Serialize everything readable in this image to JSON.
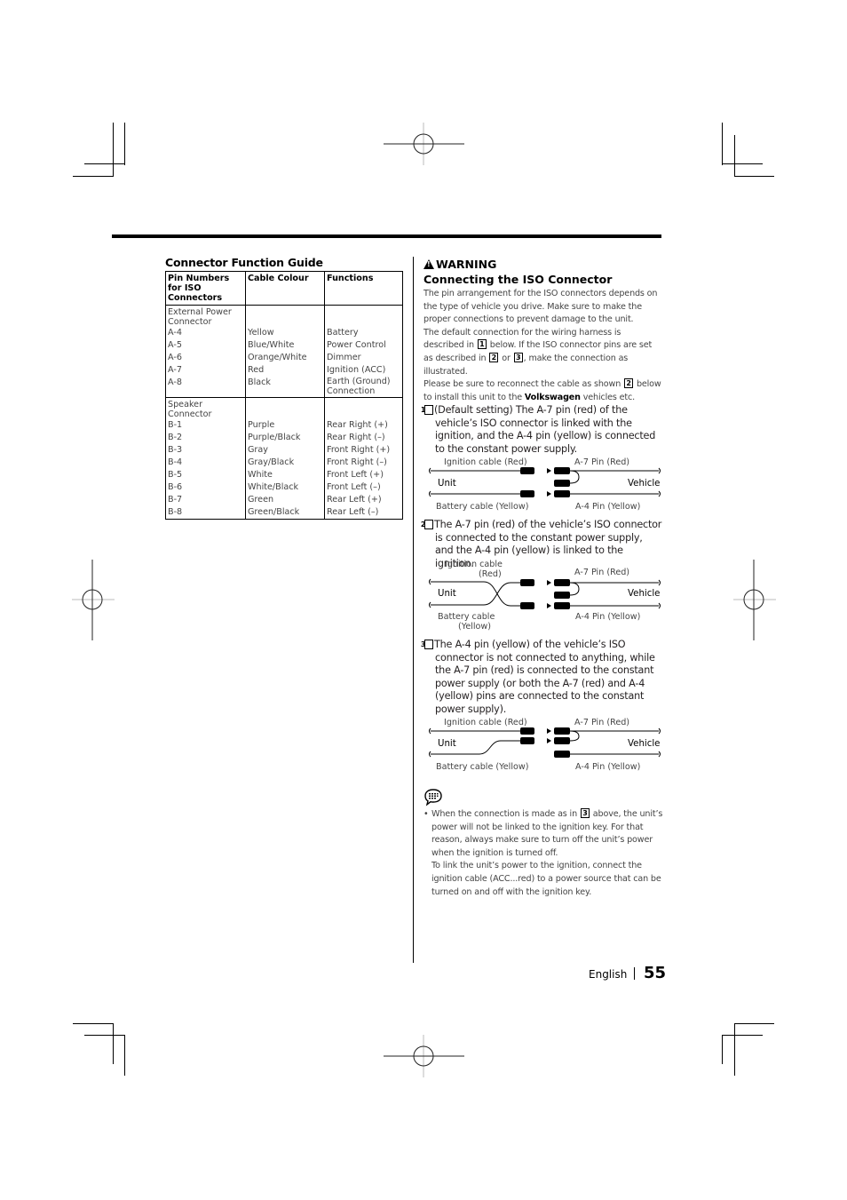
{
  "connector_guide": {
    "title": "Connector Function Guide",
    "headers": [
      "Pin Numbers for ISO Connectors",
      "Cable Colour",
      "Functions"
    ],
    "groups": [
      {
        "name": "External Power Connector",
        "rows": [
          {
            "pin": "A-4",
            "colour": "Yellow",
            "function": "Battery"
          },
          {
            "pin": "A-5",
            "colour": "Blue/White",
            "function": "Power Control"
          },
          {
            "pin": "A-6",
            "colour": "Orange/White",
            "function": "Dimmer"
          },
          {
            "pin": "A-7",
            "colour": "Red",
            "function": "Ignition (ACC)"
          },
          {
            "pin": "A-8",
            "colour": "Black",
            "function": "Earth (Ground) Connection"
          }
        ]
      },
      {
        "name": "Speaker Connector",
        "rows": [
          {
            "pin": "B-1",
            "colour": "Purple",
            "function": "Rear Right (+)"
          },
          {
            "pin": "B-2",
            "colour": "Purple/Black",
            "function": "Rear Right (–)"
          },
          {
            "pin": "B-3",
            "colour": "Gray",
            "function": "Front Right (+)"
          },
          {
            "pin": "B-4",
            "colour": "Gray/Black",
            "function": "Front Right (–)"
          },
          {
            "pin": "B-5",
            "colour": "White",
            "function": "Front Left (+)"
          },
          {
            "pin": "B-6",
            "colour": "White/Black",
            "function": "Front Left (–)"
          },
          {
            "pin": "B-7",
            "colour": "Green",
            "function": "Rear Left (+)"
          },
          {
            "pin": "B-8",
            "colour": "Green/Black",
            "function": "Rear Left (–)"
          }
        ]
      }
    ]
  },
  "warning": {
    "label": "WARNING",
    "icon": "warning-triangle-icon",
    "title": "Connecting the ISO Connector",
    "intro_1": "The pin arrangement for the ISO connectors depends on the type of vehicle you drive. Make sure to make the proper connections to prevent damage to the unit.",
    "intro_2a": "The default connection for the wiring harness is described in ",
    "intro_2b": " below. If the ISO connector pins are set as described in ",
    "intro_2c": " or ",
    "intro_2d": ", make the connection as illustrated.",
    "intro_3a": "Please be sure to reconnect the cable as shown ",
    "intro_3b": " below to install this unit to the ",
    "intro_3_bold": "Volkswagen",
    "intro_3c": " vehicles etc.",
    "box_1": "1",
    "box_2": "2",
    "box_3": "3"
  },
  "cases": [
    {
      "number": "1",
      "text": "(Default setting) The A-7 pin (red) of the vehicle’s ISO connector is linked with the ignition, and the A-4 pin (yellow) is connected to the constant power supply.",
      "labels": {
        "top_left": "Ignition cable (Red)",
        "top_right": "A-7 Pin (Red)",
        "unit": "Unit",
        "vehicle": "Vehicle",
        "bottom_left": "Battery cable (Yellow)",
        "bottom_right": "A-4 Pin (Yellow)"
      }
    },
    {
      "number": "2",
      "text": "The A-7 pin (red) of the vehicle’s ISO connector is connected to the constant power supply, and the A-4 pin (yellow) is linked to the ignition.",
      "labels": {
        "top_left_1": "Ignition cable",
        "top_left_2": "(Red)",
        "top_right": "A-7 Pin (Red)",
        "unit": "Unit",
        "vehicle": "Vehicle",
        "bottom_left_1": "Battery cable",
        "bottom_left_2": "(Yellow)",
        "bottom_right": "A-4 Pin (Yellow)"
      }
    },
    {
      "number": "3",
      "text": "The A-4 pin (yellow) of the vehicle’s ISO connector is not connected to anything, while the A-7 pin (red) is connected to the constant power supply (or both the A-7 (red) and A-4 (yellow) pins are connected to the constant power supply).",
      "labels": {
        "top_left": "Ignition cable (Red)",
        "top_right": "A-7 Pin (Red)",
        "unit": "Unit",
        "vehicle": "Vehicle",
        "bottom_left": "Battery cable (Yellow)",
        "bottom_right": "A-4 Pin (Yellow)"
      }
    }
  ],
  "note": {
    "icon": "note-memo-icon",
    "bullet": "•",
    "p1a": "When the connection is made as in ",
    "p1_box": "3",
    "p1b": " above, the unit’s power will not be linked to the ignition key. For that reason, always make sure to turn off the unit’s power when the ignition is turned off.",
    "p2": "To link the unit’s power to the ignition, connect the ignition cable (ACC...red) to a power source that can be turned on and off with the ignition key."
  },
  "footer": {
    "language": "English",
    "page_number": "55"
  }
}
